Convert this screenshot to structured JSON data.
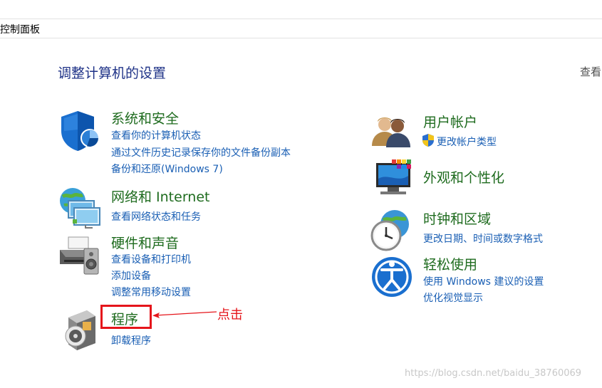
{
  "header": {
    "breadcrumb": "控制面板"
  },
  "page": {
    "title": "调整计算机的设置",
    "view_label": "查看"
  },
  "categories": {
    "security": {
      "title": "系统和安全",
      "links": [
        "查看你的计算机状态",
        "通过文件历史记录保存你的文件备份副本",
        "备份和还原(Windows 7)"
      ]
    },
    "network": {
      "title": "网络和 Internet",
      "links": [
        "查看网络状态和任务"
      ]
    },
    "hardware": {
      "title": "硬件和声音",
      "links": [
        "查看设备和打印机",
        "添加设备",
        "调整常用移动设置"
      ]
    },
    "programs": {
      "title": "程序",
      "links": [
        "卸载程序"
      ]
    },
    "accounts": {
      "title": "用户帐户",
      "links": [
        "更改帐户类型"
      ]
    },
    "appearance": {
      "title": "外观和个性化",
      "links": []
    },
    "clock": {
      "title": "时钟和区域",
      "links": [
        "更改日期、时间或数字格式"
      ]
    },
    "ease": {
      "title": "轻松使用",
      "links": [
        "使用 Windows 建议的设置",
        "优化视觉显示"
      ]
    }
  },
  "annotation": {
    "text": "点击",
    "color": "#e5151b"
  },
  "watermark": "https://blog.csdn.net/baidu_38760069",
  "colors": {
    "title_green": "#1e6b1e",
    "link_blue": "#1a5fb4",
    "heading_blue": "#1e3287"
  }
}
